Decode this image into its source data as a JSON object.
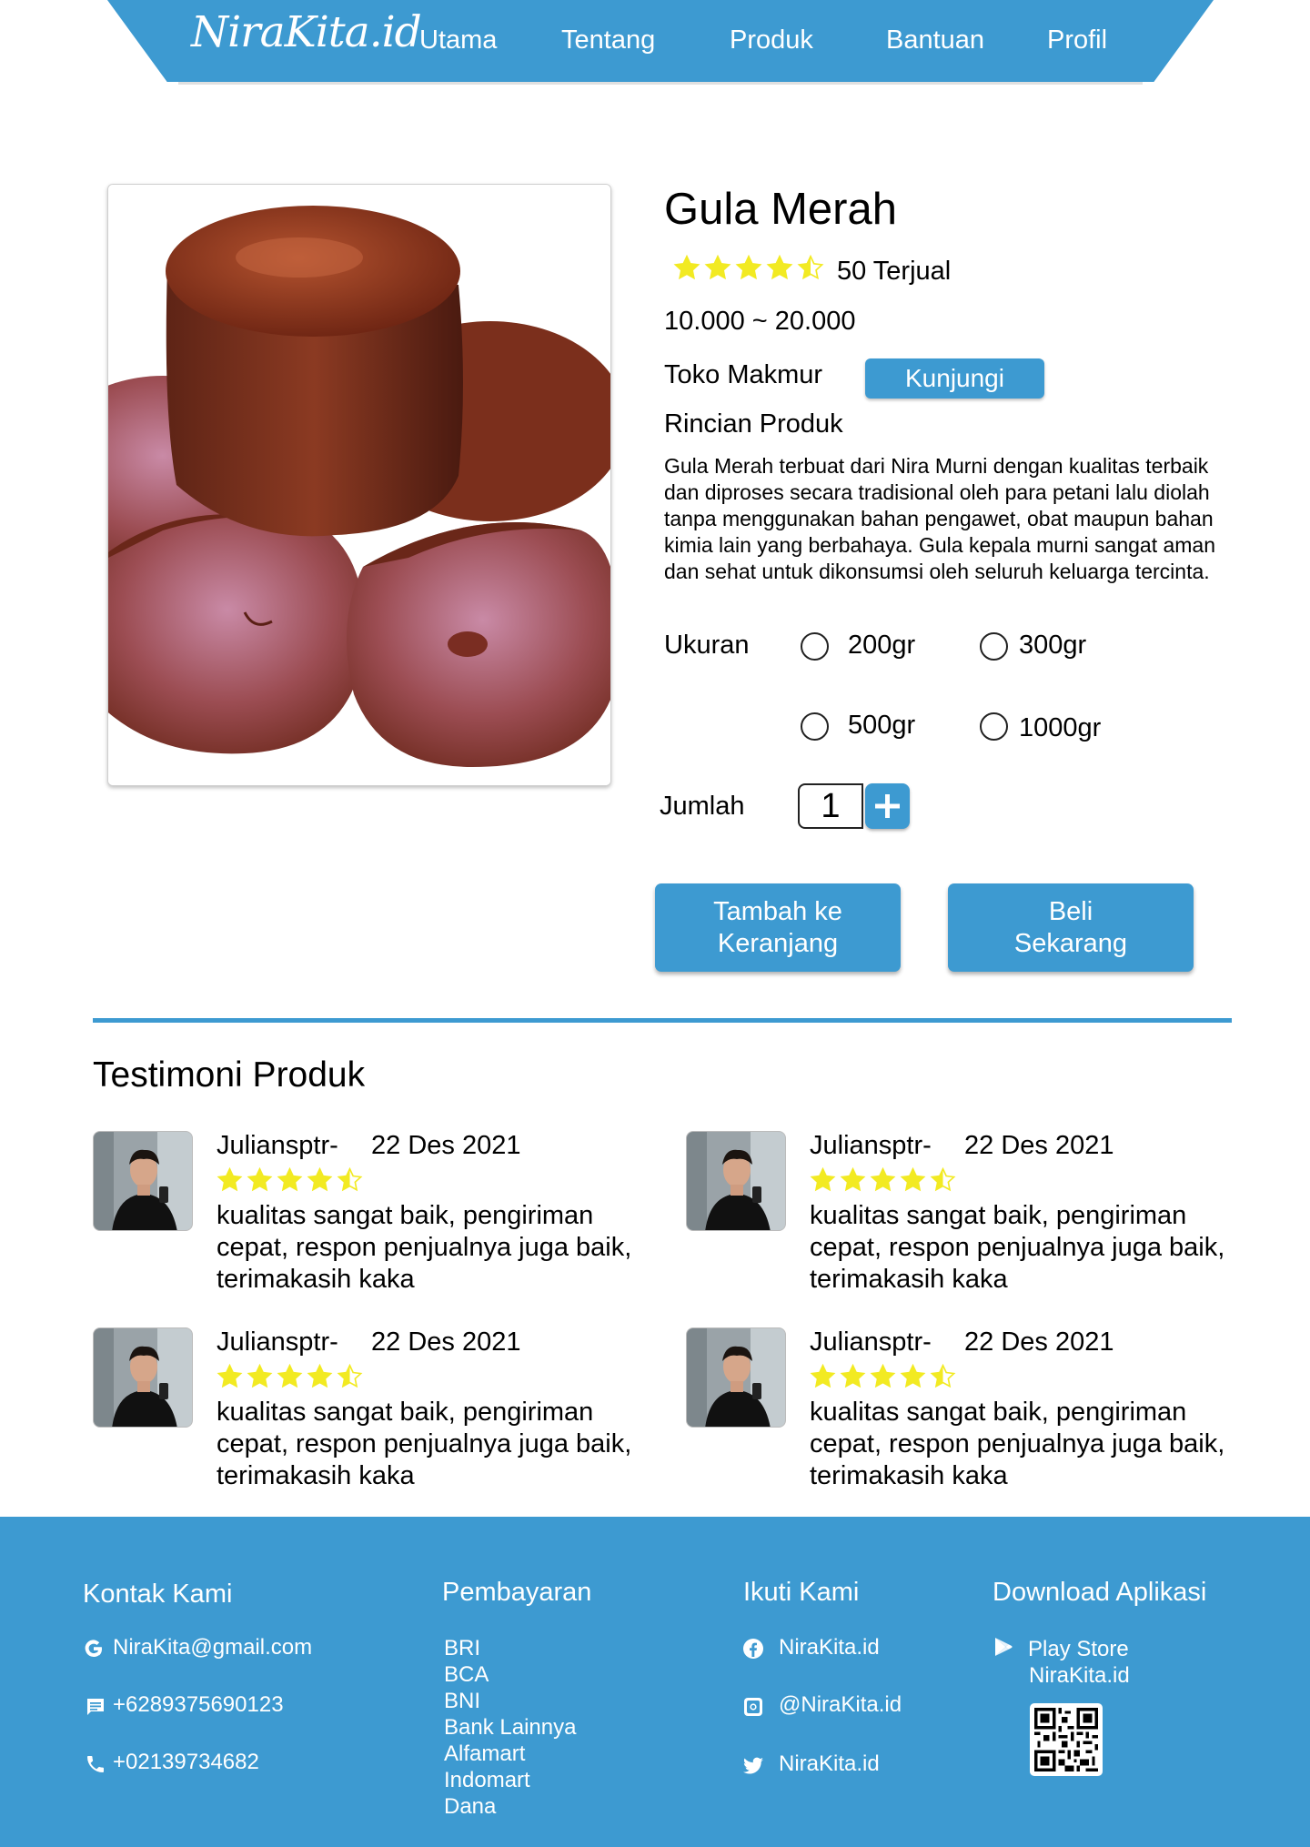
{
  "nav": {
    "logo": "NiraKita.id",
    "links": [
      "Utama",
      "Tentang",
      "Produk",
      "Bantuan",
      "Profil"
    ]
  },
  "product": {
    "title": "Gula Merah",
    "rating": 4.5,
    "sold": "50 Terjual",
    "price": "10.000 ~ 20.000",
    "store": "Toko Makmur",
    "visit_label": "Kunjungi",
    "details_heading": "Rincian Produk",
    "description": "Gula Merah terbuat dari Nira Murni dengan kualitas terbaik dan diproses secara tradisional oleh para petani lalu diolah tanpa menggunakan bahan pengawet, obat maupun bahan kimia lain yang berbahaya. Gula kepala murni sangat aman dan sehat untuk dikonsumsi oleh seluruh keluarga tercinta.",
    "size_label": "Ukuran",
    "sizes": [
      "200gr",
      "300gr",
      "500gr",
      "1000gr"
    ],
    "qty_label": "Jumlah",
    "qty_value": "1",
    "add_to_cart": "Tambah ke Keranjang",
    "buy_now": "Beli Sekarang"
  },
  "testimonials": {
    "heading": "Testimoni Produk",
    "items": [
      {
        "name": "Juliansptr-",
        "date": "22 Des 2021",
        "rating": 4.5,
        "text": "kualitas sangat baik, pengiriman cepat, respon penjualnya juga baik, terimakasih kaka"
      },
      {
        "name": "Juliansptr-",
        "date": "22 Des 2021",
        "rating": 4.5,
        "text": "kualitas sangat baik, pengiriman cepat, respon penjualnya juga baik, terimakasih kaka"
      },
      {
        "name": "Juliansptr-",
        "date": "22 Des 2021",
        "rating": 4.5,
        "text": "kualitas sangat baik, pengiriman cepat, respon penjualnya juga baik, terimakasih kaka"
      },
      {
        "name": "Juliansptr-",
        "date": "22 Des 2021",
        "rating": 4.5,
        "text": "kualitas sangat baik, pengiriman cepat, respon penjualnya juga baik, terimakasih kaka"
      }
    ]
  },
  "footer": {
    "contact_heading": "Kontak Kami",
    "email": "NiraKita@gmail.com",
    "phone": "+6289375690123",
    "tel": "+02139734682",
    "payment_heading": "Pembayaran",
    "payments": [
      "BRI",
      "BCA",
      "BNI",
      "Bank Lainnya",
      "Alfamart",
      "Indomart",
      "Dana"
    ],
    "follow_heading": "Ikuti Kami",
    "facebook": "NiraKita.id",
    "instagram": "@NiraKita.id",
    "twitter": "NiraKita.id",
    "download_heading": "Download Aplikasi",
    "play_store": "Play Store",
    "play_store_name": "NiraKita.id"
  },
  "colors": {
    "primary": "#3d9ad1",
    "star": "#f2ea22",
    "white": "#ffffff"
  },
  "icons": {
    "email": "google-icon",
    "phone": "chat-icon",
    "tel": "phone-icon",
    "facebook": "facebook-icon",
    "instagram": "instagram-icon",
    "twitter": "twitter-icon",
    "play_store": "play-store-icon",
    "qr": "qr-code-icon",
    "plus": "plus-icon"
  }
}
